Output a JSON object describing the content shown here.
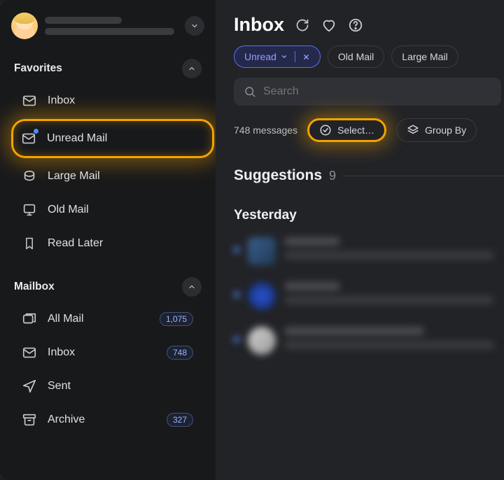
{
  "profile": {
    "chevron_icon": "chevron-down"
  },
  "sidebar": {
    "sections": {
      "favorites": {
        "title": "Favorites",
        "items": [
          {
            "label": "Inbox",
            "icon": "envelope"
          },
          {
            "label": "Unread Mail",
            "icon": "envelope-dot",
            "highlighted": true
          },
          {
            "label": "Large Mail",
            "icon": "package"
          },
          {
            "label": "Old Mail",
            "icon": "screen"
          },
          {
            "label": "Read Later",
            "icon": "bookmark"
          }
        ]
      },
      "mailbox": {
        "title": "Mailbox",
        "items": [
          {
            "label": "All Mail",
            "icon": "all-mail",
            "count": "1,075"
          },
          {
            "label": "Inbox",
            "icon": "envelope",
            "count": "748"
          },
          {
            "label": "Sent",
            "icon": "paper-plane"
          },
          {
            "label": "Archive",
            "icon": "archive",
            "count": "327"
          }
        ]
      }
    }
  },
  "main": {
    "title": "Inbox",
    "header_icons": [
      "refresh",
      "heart",
      "help"
    ],
    "filter_chips": {
      "active": {
        "label": "Unread",
        "closable": true
      },
      "others": [
        "Old Mail",
        "Large Mail"
      ]
    },
    "search": {
      "placeholder": "Search",
      "value": ""
    },
    "message_bar": {
      "count_text": "748 messages",
      "select_label": "Select…",
      "group_label": "Group By"
    },
    "suggestions": {
      "title": "Suggestions",
      "count": "9"
    },
    "group_header": "Yesterday",
    "highlights": {
      "unread_mail_sidebar": true,
      "select_pill": true
    },
    "colors": {
      "accent_blue": "#5a6ff0",
      "highlight_yellow": "#f4a300",
      "bg_sidebar": "#18191b",
      "bg_main": "#222327"
    }
  }
}
